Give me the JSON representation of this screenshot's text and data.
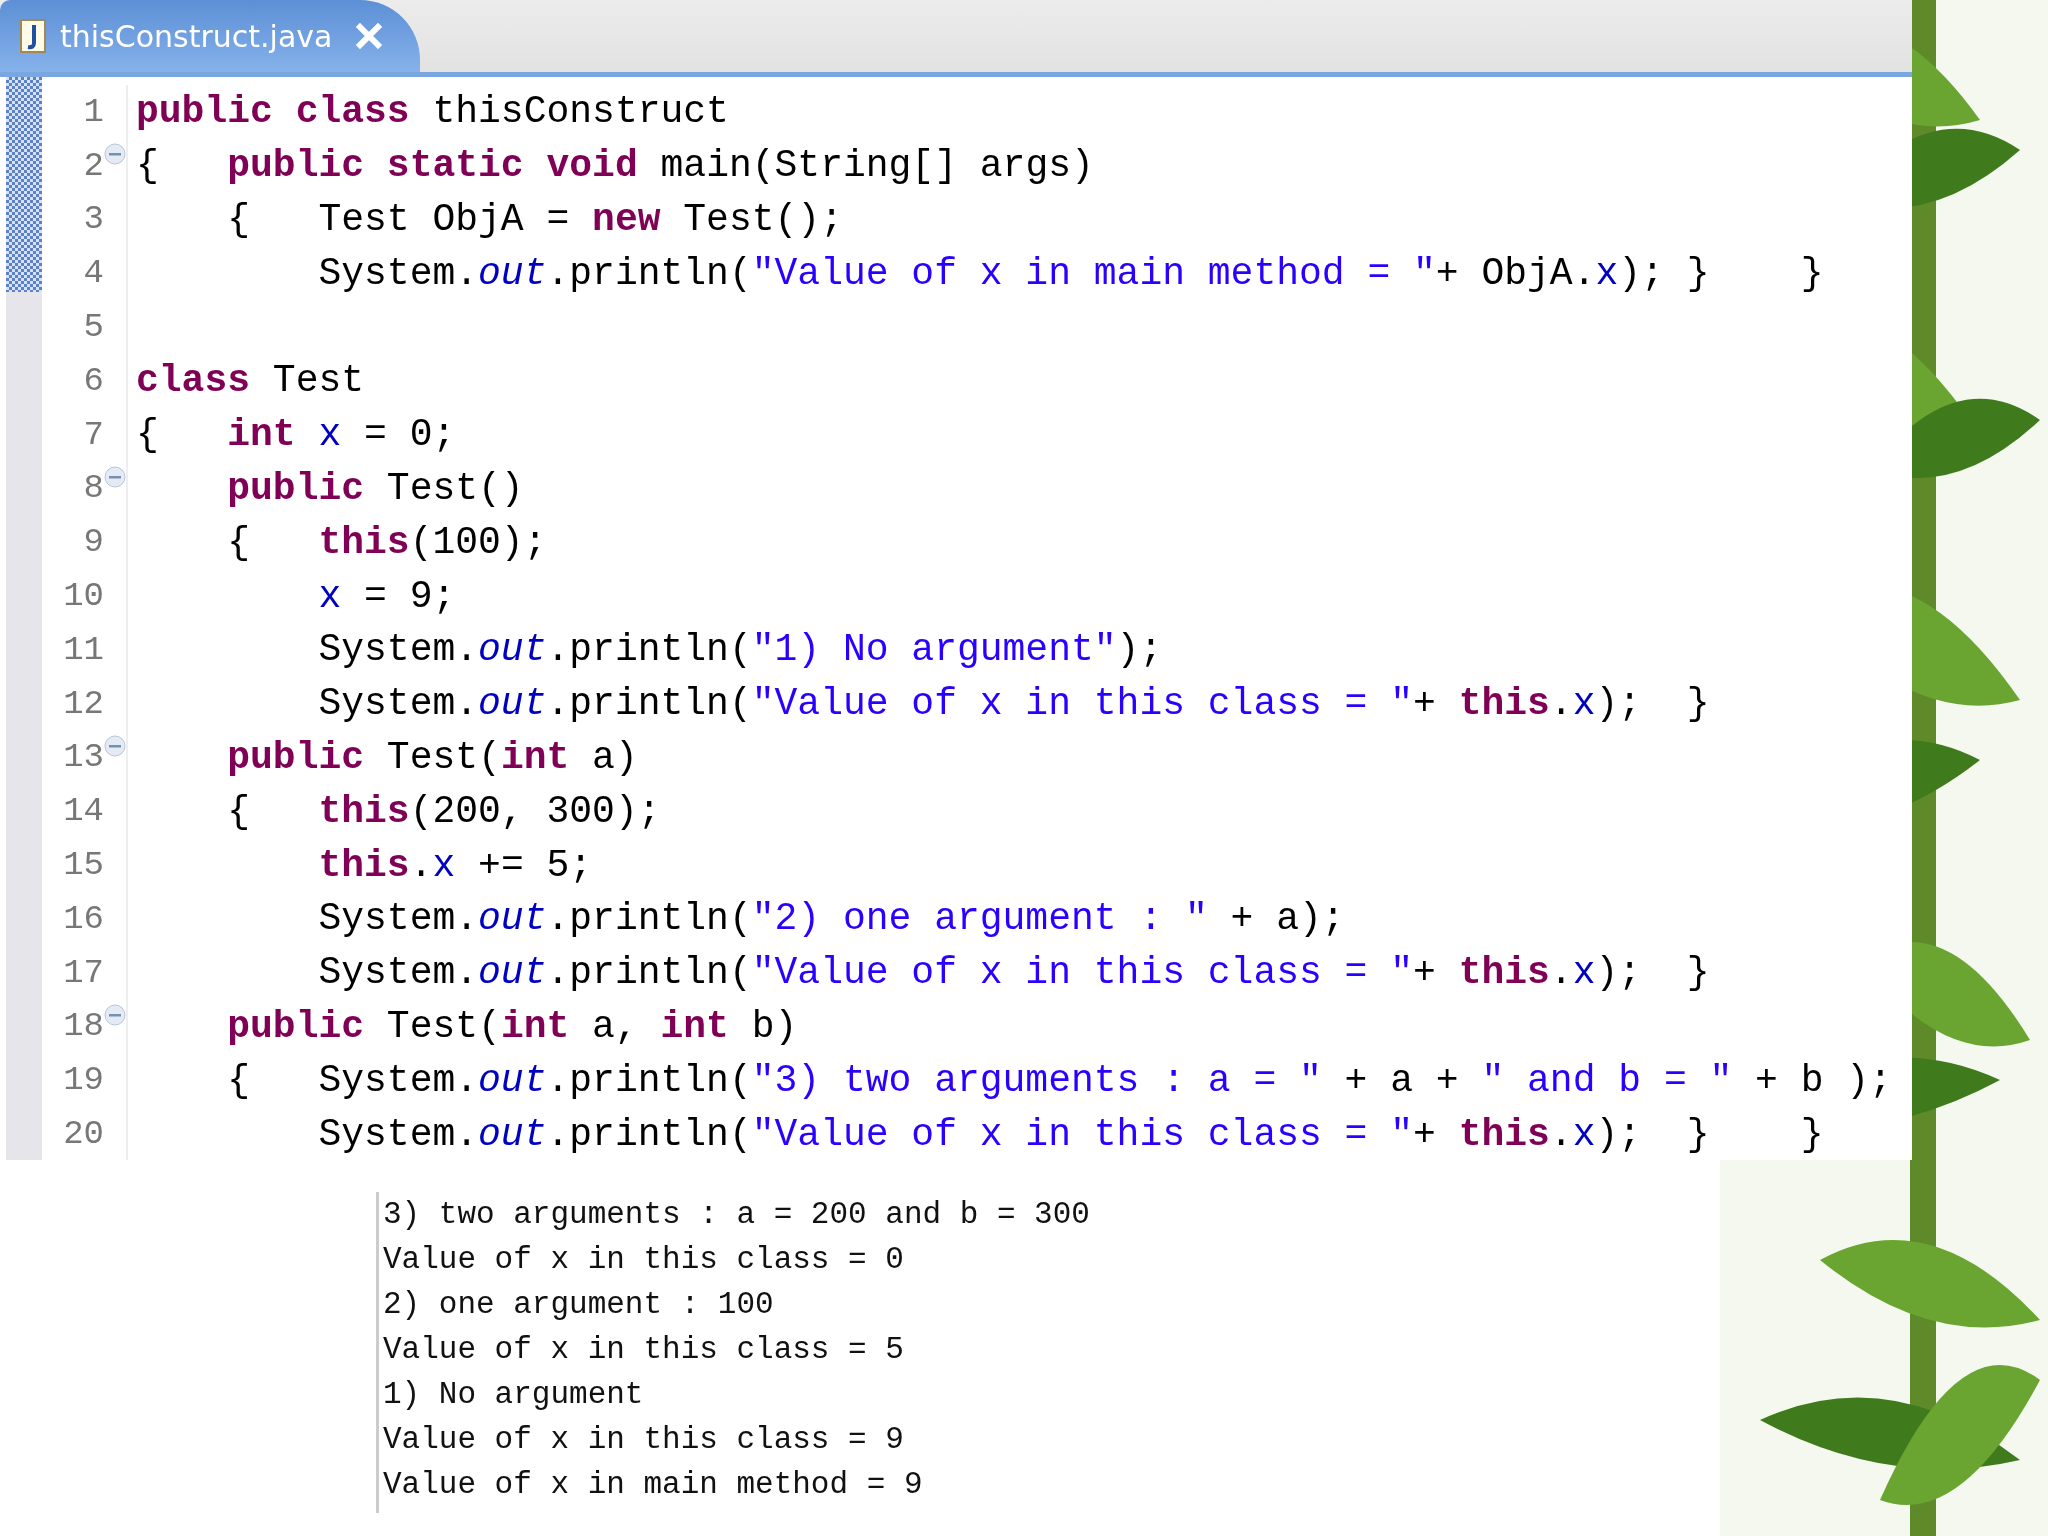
{
  "editor": {
    "tab": {
      "title": "thisConstruct.java"
    },
    "lines": [
      {
        "number": "1",
        "foldable": false,
        "tokens": [
          {
            "kind": "kw",
            "t": "public"
          },
          {
            "kind": "kw",
            "t": " class"
          },
          {
            "kind": "p",
            "t": " thisConstruct"
          }
        ]
      },
      {
        "number": "2",
        "foldable": true,
        "tokens": [
          {
            "kind": "p",
            "t": "{   "
          },
          {
            "kind": "kw",
            "t": "public"
          },
          {
            "kind": "kw",
            "t": " static"
          },
          {
            "kind": "kw",
            "t": " void"
          },
          {
            "kind": "p",
            "t": " main(String[] args)"
          }
        ]
      },
      {
        "number": "3",
        "foldable": false,
        "tokens": [
          {
            "kind": "p",
            "t": "    {   Test ObjA = "
          },
          {
            "kind": "kw",
            "t": "new"
          },
          {
            "kind": "p",
            "t": " Test();"
          }
        ]
      },
      {
        "number": "4",
        "foldable": false,
        "tokens": [
          {
            "kind": "p",
            "t": "        System."
          },
          {
            "kind": "st",
            "t": "out"
          },
          {
            "kind": "p",
            "t": ".println("
          },
          {
            "kind": "s",
            "t": "\"Value of x in main method = \""
          },
          {
            "kind": "p",
            "t": "+ ObjA."
          },
          {
            "kind": "f",
            "t": "x"
          },
          {
            "kind": "p",
            "t": "); }    }"
          }
        ]
      },
      {
        "number": "5",
        "foldable": false
      },
      {
        "number": "6",
        "foldable": false,
        "tokens": [
          {
            "kind": "kw",
            "t": "class"
          },
          {
            "kind": "p",
            "t": " Test"
          }
        ]
      },
      {
        "number": "7",
        "foldable": false,
        "tokens": [
          {
            "kind": "p",
            "t": "{   "
          },
          {
            "kind": "kw",
            "t": "int"
          },
          {
            "kind": "f",
            "t": " x"
          },
          {
            "kind": "p",
            "t": " = 0;"
          }
        ]
      },
      {
        "number": "8",
        "foldable": true,
        "tokens": [
          {
            "kind": "kw",
            "t": "    public"
          },
          {
            "kind": "p",
            "t": " Test()"
          }
        ]
      },
      {
        "number": "9",
        "foldable": false,
        "tokens": [
          {
            "kind": "p",
            "t": "    {   "
          },
          {
            "kind": "kw",
            "t": "this"
          },
          {
            "kind": "p",
            "t": "(100);"
          }
        ]
      },
      {
        "number": "10",
        "foldable": false,
        "tokens": [
          {
            "kind": "f",
            "t": "        x"
          },
          {
            "kind": "p",
            "t": " = 9;"
          }
        ]
      },
      {
        "number": "11",
        "foldable": false,
        "tokens": [
          {
            "kind": "p",
            "t": "        System."
          },
          {
            "kind": "st",
            "t": "out"
          },
          {
            "kind": "p",
            "t": ".println("
          },
          {
            "kind": "s",
            "t": "\"1) No argument\""
          },
          {
            "kind": "p",
            "t": ");"
          }
        ]
      },
      {
        "number": "12",
        "foldable": false,
        "tokens": [
          {
            "kind": "p",
            "t": "        System."
          },
          {
            "kind": "st",
            "t": "out"
          },
          {
            "kind": "p",
            "t": ".println("
          },
          {
            "kind": "s",
            "t": "\"Value of x in this class = \""
          },
          {
            "kind": "p",
            "t": "+ "
          },
          {
            "kind": "kw",
            "t": "this"
          },
          {
            "kind": "p",
            "t": "."
          },
          {
            "kind": "f",
            "t": "x"
          },
          {
            "kind": "p",
            "t": ");  }"
          }
        ]
      },
      {
        "number": "13",
        "foldable": true,
        "tokens": [
          {
            "kind": "kw",
            "t": "    public"
          },
          {
            "kind": "p",
            "t": " Test("
          },
          {
            "kind": "kw",
            "t": "int"
          },
          {
            "kind": "p",
            "t": " a)"
          }
        ]
      },
      {
        "number": "14",
        "foldable": false,
        "tokens": [
          {
            "kind": "p",
            "t": "    {   "
          },
          {
            "kind": "kw",
            "t": "this"
          },
          {
            "kind": "p",
            "t": "(200, 300);"
          }
        ]
      },
      {
        "number": "15",
        "foldable": false,
        "tokens": [
          {
            "kind": "kw",
            "t": "        this"
          },
          {
            "kind": "p",
            "t": "."
          },
          {
            "kind": "f",
            "t": "x"
          },
          {
            "kind": "p",
            "t": " += 5;"
          }
        ]
      },
      {
        "number": "16",
        "foldable": false,
        "tokens": [
          {
            "kind": "p",
            "t": "        System."
          },
          {
            "kind": "st",
            "t": "out"
          },
          {
            "kind": "p",
            "t": ".println("
          },
          {
            "kind": "s",
            "t": "\"2) one argument : \""
          },
          {
            "kind": "p",
            "t": " + a);"
          }
        ]
      },
      {
        "number": "17",
        "foldable": false,
        "tokens": [
          {
            "kind": "p",
            "t": "        System."
          },
          {
            "kind": "st",
            "t": "out"
          },
          {
            "kind": "p",
            "t": ".println("
          },
          {
            "kind": "s",
            "t": "\"Value of x in this class = \""
          },
          {
            "kind": "p",
            "t": "+ "
          },
          {
            "kind": "kw",
            "t": "this"
          },
          {
            "kind": "p",
            "t": "."
          },
          {
            "kind": "f",
            "t": "x"
          },
          {
            "kind": "p",
            "t": ");  }"
          }
        ]
      },
      {
        "number": "18",
        "foldable": true,
        "tokens": [
          {
            "kind": "kw",
            "t": "    public"
          },
          {
            "kind": "p",
            "t": " Test("
          },
          {
            "kind": "kw",
            "t": "int"
          },
          {
            "kind": "p",
            "t": " a, "
          },
          {
            "kind": "kw",
            "t": "int"
          },
          {
            "kind": "p",
            "t": " b)"
          }
        ]
      },
      {
        "number": "19",
        "foldable": false,
        "tokens": [
          {
            "kind": "p",
            "t": "    {   System."
          },
          {
            "kind": "st",
            "t": "out"
          },
          {
            "kind": "p",
            "t": ".println("
          },
          {
            "kind": "s",
            "t": "\"3) two arguments : a = \""
          },
          {
            "kind": "p",
            "t": " + a + "
          },
          {
            "kind": "s",
            "t": "\" and b = \""
          },
          {
            "kind": "p",
            "t": " + b );"
          }
        ]
      },
      {
        "number": "20",
        "foldable": false,
        "tokens": [
          {
            "kind": "p",
            "t": "        System."
          },
          {
            "kind": "st",
            "t": "out"
          },
          {
            "kind": "p",
            "t": ".println("
          },
          {
            "kind": "s",
            "t": "\"Value of x in this class = \""
          },
          {
            "kind": "p",
            "t": "+ "
          },
          {
            "kind": "kw",
            "t": "this"
          },
          {
            "kind": "p",
            "t": "."
          },
          {
            "kind": "f",
            "t": "x"
          },
          {
            "kind": "p",
            "t": ");  }    }"
          }
        ]
      }
    ]
  },
  "output": {
    "lines": [
      "3) two arguments : a = 200 and b = 300",
      "Value of x in this class = 0",
      "2) one argument : 100",
      "Value of x in this class = 5",
      "1) No argument",
      "Value of x in this class = 9",
      "Value of x in main method = 9"
    ]
  }
}
